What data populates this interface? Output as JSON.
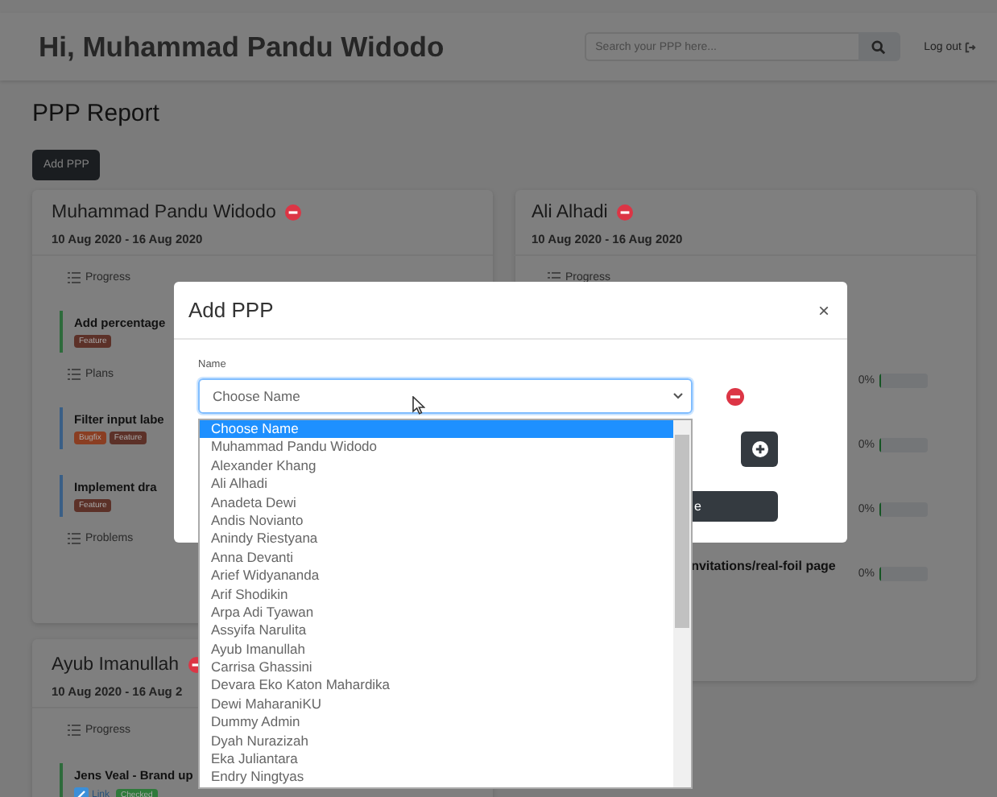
{
  "header": {
    "greeting": "Hi, Muhammad Pandu Widodo",
    "search": {
      "placeholder": "Search your PPP here..."
    },
    "logout": "Log out"
  },
  "page_title": "PPP Report",
  "add_button": "Add PPP",
  "columns": [
    [
      {
        "name": "Muhammad Pandu Widodo",
        "date": "10 Aug 2020 - 16 Aug 2020",
        "sections": [
          {
            "title": "Progress",
            "tasks": [
              {
                "title": "Add percentage",
                "color": "#2e6b3c",
                "badges": [
                  {
                    "label": "Feature",
                    "color": "#5c3128"
                  }
                ]
              }
            ]
          },
          {
            "title": "Plans",
            "tasks": [
              {
                "title": "Filter input labe",
                "color": "#3a5f86",
                "badges": [
                  {
                    "label": "Bugfix",
                    "color": "#8a3e22"
                  },
                  {
                    "label": "Feature",
                    "color": "#5c3128"
                  }
                ]
              },
              {
                "title": "Implement dra",
                "color": "#3a5f86",
                "badges": [
                  {
                    "label": "Feature",
                    "color": "#5c3128"
                  }
                ]
              }
            ]
          },
          {
            "title": "Problems"
          }
        ]
      },
      {
        "name": "Ayub Imanullah",
        "date": "10 Aug 2020 - 16 Aug 2",
        "sections": [
          {
            "title": "Progress",
            "tasks": [
              {
                "title": "Jens Veal - Brand up",
                "color": "#2e6b3c",
                "link": "Link",
                "badges": [
                  {
                    "label": "Checked",
                    "color": "#2e7a3a"
                  }
                ]
              }
            ]
          }
        ]
      }
    ],
    [
      {
        "name": "Ali Alhadi",
        "date": "10 Aug 2020 - 16 Aug 2020",
        "sections": [
          {
            "title": "Progress",
            "tasks": [
              {
                "reading": "0%",
                "level": 0
              },
              {
                "reading": "0%",
                "level": 0
              },
              {
                "reading": "0%",
                "level": 0
              },
              {
                "title": "nvitations/real-foil page",
                "reading": "0%",
                "level": 0
              }
            ]
          }
        ]
      }
    ]
  ],
  "modal": {
    "title": "Add PPP",
    "close": "×",
    "name_label": "Name",
    "select_value": "Choose Name",
    "save_button": "e",
    "options": [
      {
        "label": "Choose Name",
        "selected": true
      },
      {
        "label": "Muhammad Pandu Widodo",
        "selected": false
      },
      {
        "label": "Alexander Khang",
        "selected": false
      },
      {
        "label": "Ali Alhadi",
        "selected": false
      },
      {
        "label": "Anadeta Dewi",
        "selected": false
      },
      {
        "label": "Andis Novianto",
        "selected": false
      },
      {
        "label": "Anindy Riestyana",
        "selected": false
      },
      {
        "label": "Anna Devanti",
        "selected": false
      },
      {
        "label": "Arief Widyananda",
        "selected": false
      },
      {
        "label": "Arif Shodikin",
        "selected": false
      },
      {
        "label": "Arpa Adi Tyawan",
        "selected": false
      },
      {
        "label": "Assyifa Narulita",
        "selected": false
      },
      {
        "label": "Ayub Imanullah",
        "selected": false
      },
      {
        "label": "Carrisa Ghassini",
        "selected": false
      },
      {
        "label": "Devara Eko Katon Mahardika",
        "selected": false
      },
      {
        "label": "Dewi MaharaniKU",
        "selected": false
      },
      {
        "label": "Dummy Admin",
        "selected": false
      },
      {
        "label": "Dyah Nurazizah",
        "selected": false
      },
      {
        "label": "Eka Juliantara",
        "selected": false
      },
      {
        "label": "Endry Ningtyas",
        "selected": false
      }
    ]
  }
}
